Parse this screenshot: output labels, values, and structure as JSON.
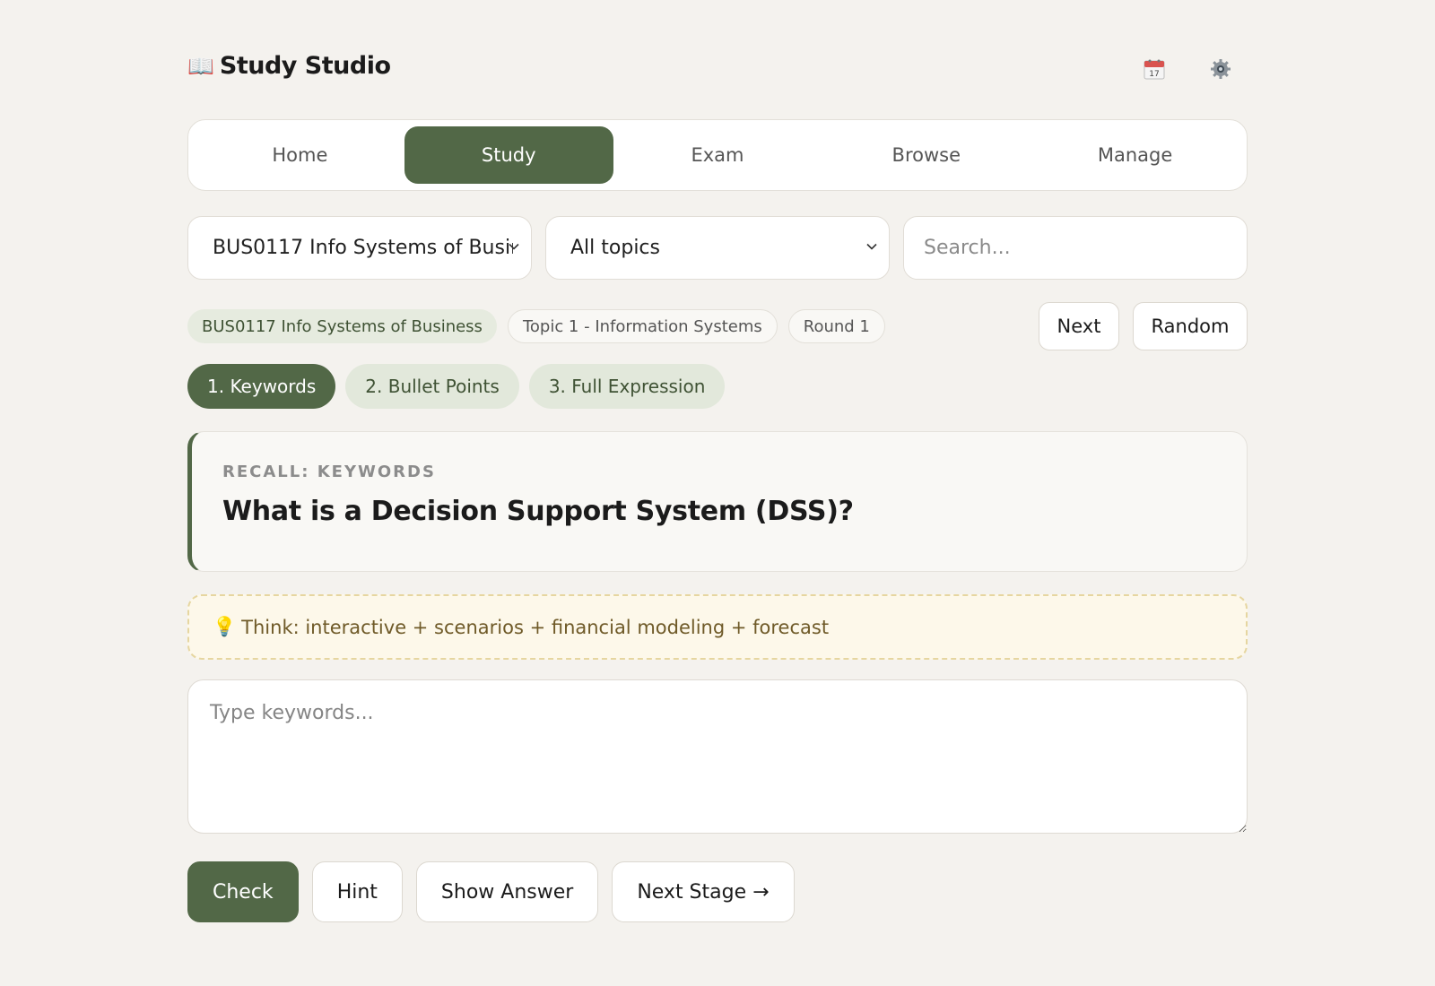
{
  "app": {
    "title": "Study Studio",
    "brand_icon": "📖"
  },
  "header": {
    "calendar_day": "17"
  },
  "tabs": [
    {
      "label": "Home",
      "active": false
    },
    {
      "label": "Study",
      "active": true
    },
    {
      "label": "Exam",
      "active": false
    },
    {
      "label": "Browse",
      "active": false
    },
    {
      "label": "Manage",
      "active": false
    }
  ],
  "filters": {
    "course": "BUS0117 Info Systems of Business",
    "topic": "All topics",
    "search_placeholder": "Search..."
  },
  "chips": {
    "course": "BUS0117 Info Systems of Business",
    "topic": "Topic 1 - Information Systems",
    "round": "Round 1"
  },
  "nav": {
    "next": "Next",
    "random": "Random"
  },
  "stages": [
    {
      "label": "1. Keywords",
      "active": true
    },
    {
      "label": "2. Bullet Points",
      "active": false
    },
    {
      "label": "3. Full Expression",
      "active": false
    }
  ],
  "question": {
    "label": "RECALL: KEYWORDS",
    "text": "What is a Decision Support System (DSS)?"
  },
  "hint": {
    "icon": "💡",
    "text": "Think: interactive + scenarios + financial modeling + forecast"
  },
  "answer": {
    "placeholder": "Type keywords...",
    "value": ""
  },
  "actions": {
    "check": "Check",
    "hint": "Hint",
    "show_answer": "Show Answer",
    "next_stage": "Next Stage →"
  },
  "colors": {
    "accent": "#526847",
    "background": "#f4f2ee",
    "hint_bg": "#fdf8ea"
  }
}
